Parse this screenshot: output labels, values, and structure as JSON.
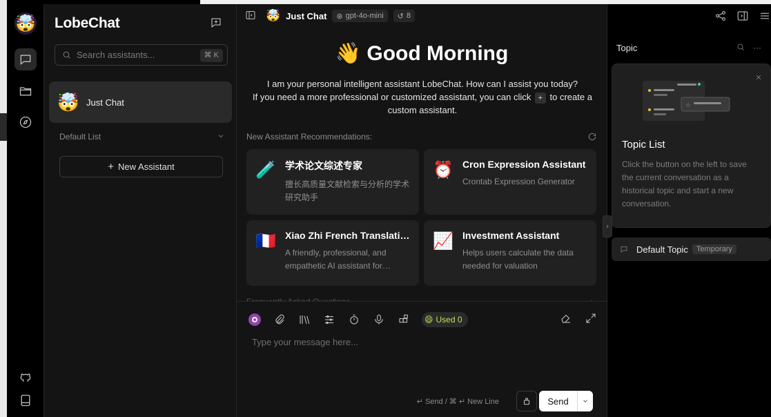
{
  "app": {
    "name": "LobeChat"
  },
  "sidebar": {
    "search_placeholder": "Search assistants...",
    "search_shortcut": "⌘ K",
    "active_session": {
      "name": "Just Chat",
      "emoji": "🤯"
    },
    "group_label": "Default List",
    "new_assistant_label": "New Assistant"
  },
  "header": {
    "title": "Just Chat",
    "emoji": "🤯",
    "model": "gpt-4o-mini",
    "history_count": "8"
  },
  "welcome": {
    "greeting": "👋 Good Morning",
    "intro_line1": "I am your personal intelligent assistant LobeChat. How can I assist you today?",
    "intro_line2_before": "If you need a more professional or customized assistant, you can click",
    "intro_plus": "+",
    "intro_line2_after": "to create a custom assistant.",
    "recommendations_title": "New Assistant Recommendations:",
    "faq_title": "Frequently Asked Questions"
  },
  "cards": [
    {
      "emoji": "🧪",
      "title": "学术论文综述专家",
      "desc": "擅长高质量文献检索与分析的学术研究助手"
    },
    {
      "emoji": "⏰",
      "title": "Cron Expression Assistant",
      "desc": "Crontab Expression Generator"
    },
    {
      "emoji": "🇫🇷",
      "title": "Xiao Zhi French Translati…",
      "desc": "A friendly, professional, and empathetic AI assistant for…"
    },
    {
      "emoji": "📈",
      "title": "Investment Assistant",
      "desc": "Helps users calculate the data needed for valuation"
    }
  ],
  "composer": {
    "used_label": "Used 0",
    "placeholder": "Type your message here...",
    "send_hint": "↵ Send / ⌘ ↵ New Line",
    "send_label": "Send"
  },
  "topics": {
    "title": "Topic",
    "tip_heading": "Topic List",
    "tip_desc": "Click the button on the left to save the current conversation as a historical topic and start a new conversation.",
    "default_topic": "Default Topic",
    "default_topic_tag": "Temporary"
  },
  "colors": {
    "background": "#141414",
    "rail": "#000000",
    "card": "#212121",
    "accent_used": "#b7e35b",
    "send_bg": "#ffffff"
  }
}
